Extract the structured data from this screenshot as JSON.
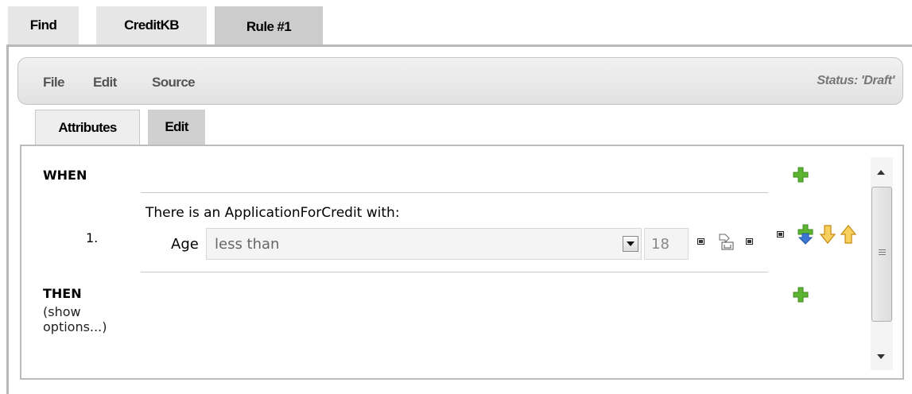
{
  "top_tabs": [
    "Find",
    "CreditKB",
    "Rule #1"
  ],
  "menu": {
    "file": "File",
    "edit": "Edit",
    "source": "Source",
    "status": "Status: 'Draft'"
  },
  "inner_tabs": [
    "Attributes",
    "Edit"
  ],
  "rule": {
    "when_label": "WHEN",
    "then_label": "THEN",
    "show_options_line1": "(show",
    "show_options_line2": "options...)",
    "row_number": "1.",
    "pattern_text": "There is an ApplicationForCredit with:",
    "field_label": "Age",
    "operator_value": "less than",
    "value": "18"
  },
  "icons": {
    "add_when": "green-plus-icon",
    "add_then": "green-plus-icon",
    "insert_row": "blue-arrow-plus-icon",
    "move_down": "yellow-arrow-down-icon",
    "move_up": "yellow-arrow-up-icon",
    "variable_binding": "bind-variable-icon"
  },
  "colors": {
    "tab_bg": "#e6e6e6",
    "tab_active_bg": "#cccccc",
    "plus_green": "#5cb531",
    "arrow_yellow": "#f2b823",
    "arrow_blue": "#3a78d4"
  }
}
